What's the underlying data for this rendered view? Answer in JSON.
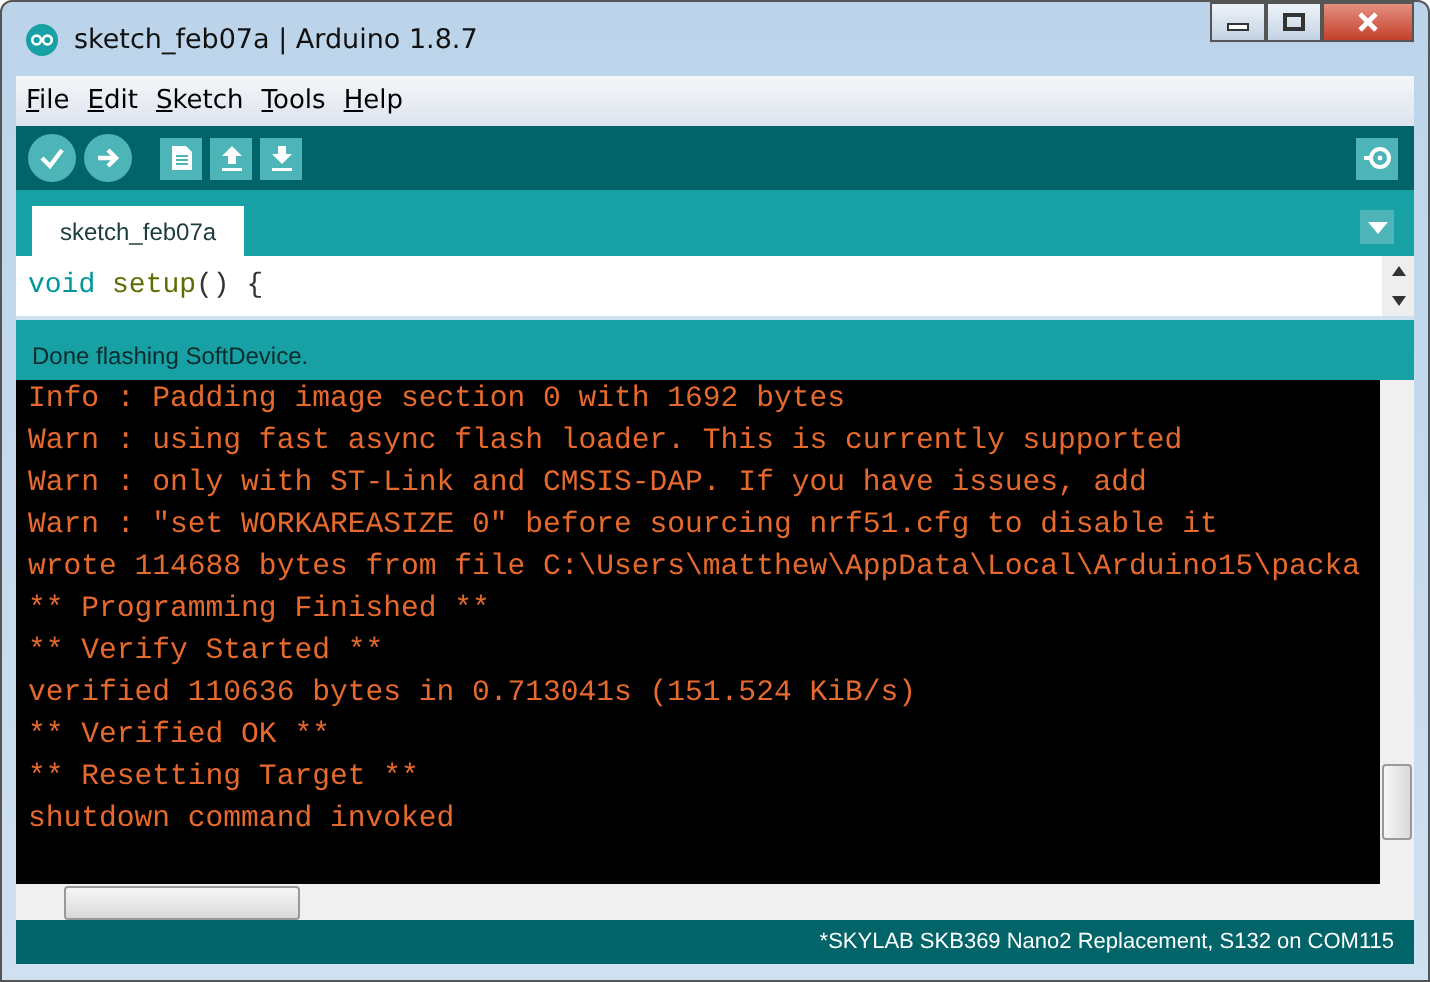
{
  "window": {
    "title": "sketch_feb07a | Arduino 1.8.7"
  },
  "menu": [
    {
      "label": "File"
    },
    {
      "label": "Edit"
    },
    {
      "label": "Sketch"
    },
    {
      "label": "Tools"
    },
    {
      "label": "Help"
    }
  ],
  "tabs": [
    {
      "label": "sketch_feb07a",
      "selected": true
    }
  ],
  "editor": {
    "tokens": [
      {
        "kind": "keyword",
        "text": "void"
      },
      {
        "kind": "function",
        "text": "setup"
      },
      {
        "kind": "plain",
        "text": "() {"
      }
    ]
  },
  "message": "Done flashing SoftDevice.",
  "console": [
    "Info : Padding image section 0 with 1692 bytes",
    "Warn : using fast async flash loader. This is currently supported",
    "Warn : only with ST-Link and CMSIS-DAP. If you have issues, add",
    "Warn : \"set WORKAREASIZE 0\" before sourcing nrf51.cfg to disable it",
    "wrote 114688 bytes from file C:\\Users\\matthew\\AppData\\Local\\Arduino15\\packa",
    "** Programming Finished **",
    "** Verify Started **",
    "verified 110636 bytes in 0.713041s (151.524 KiB/s)",
    "** Verified OK **",
    "** Resetting Target **",
    "shutdown command invoked"
  ],
  "status_bar": "*SKYLAB SKB369 Nano2 Replacement, S132 on COM115"
}
